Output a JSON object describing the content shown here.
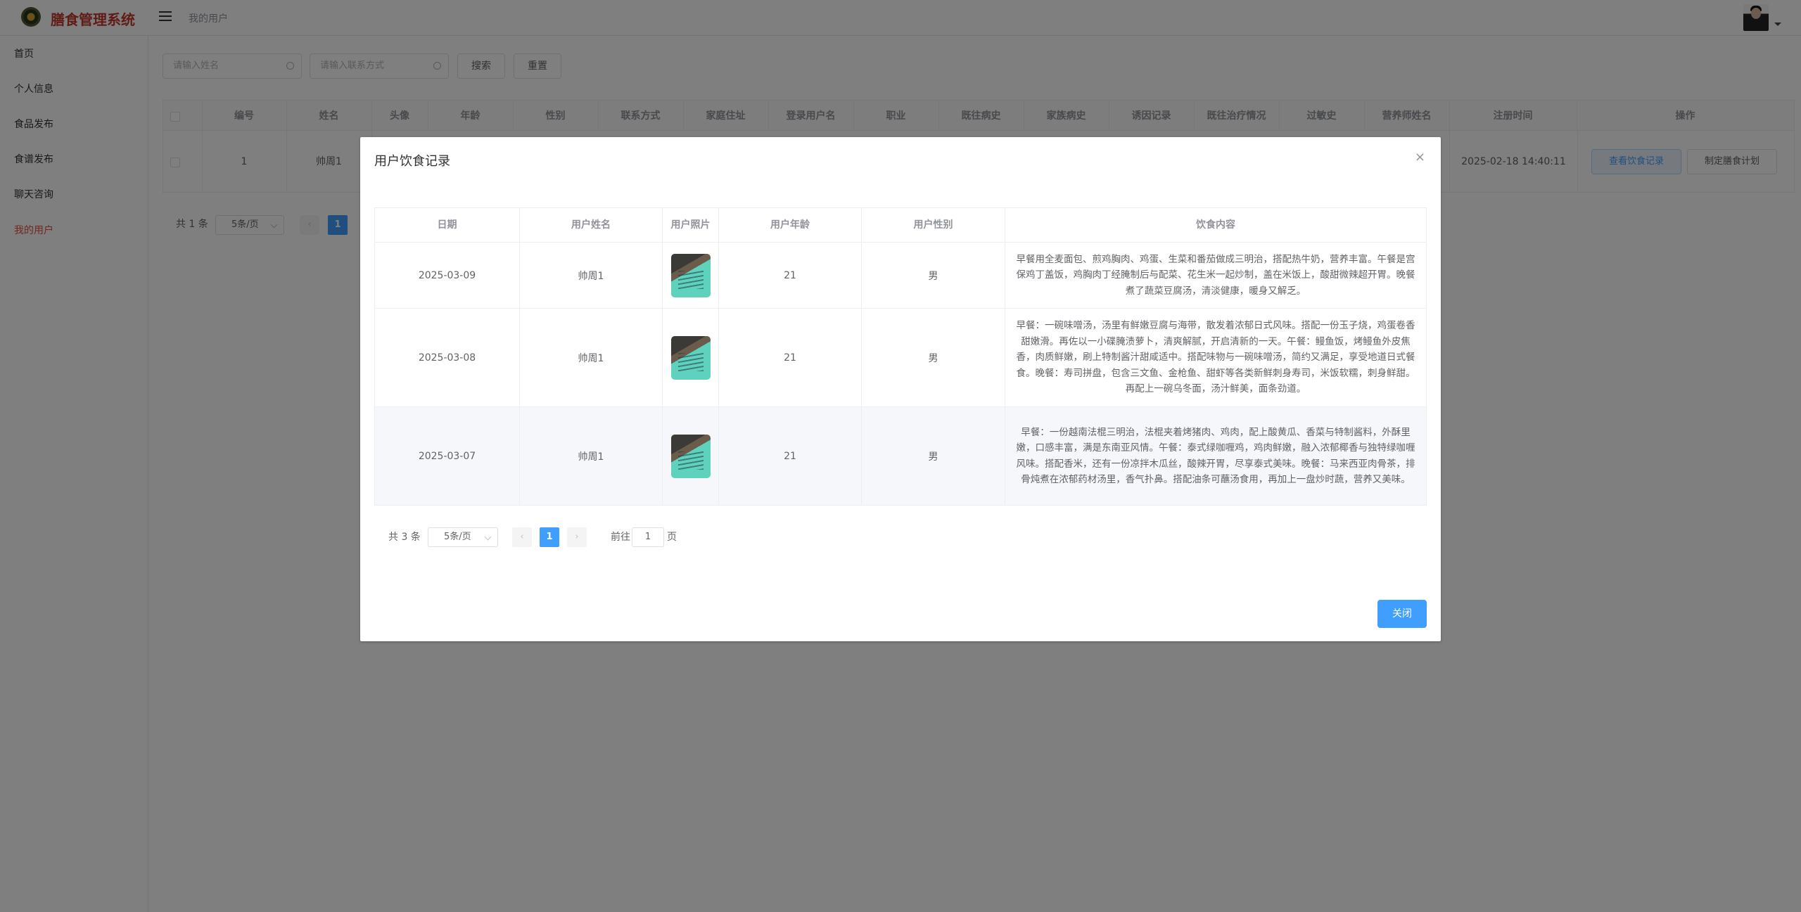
{
  "app": {
    "title": "膳食管理系统"
  },
  "header": {
    "breadcrumb": "我的用户"
  },
  "sidebar": {
    "items": [
      {
        "label": "首页"
      },
      {
        "label": "个人信息"
      },
      {
        "label": "食品发布"
      },
      {
        "label": "食谱发布"
      },
      {
        "label": "聊天咨询"
      },
      {
        "label": "我的用户"
      }
    ]
  },
  "search": {
    "name_placeholder": "请输入姓名",
    "contact_placeholder": "请输入联系方式",
    "search_label": "搜索",
    "reset_label": "重置"
  },
  "grid": {
    "headers": [
      "编号",
      "姓名",
      "头像",
      "年龄",
      "性别",
      "联系方式",
      "家庭住址",
      "登录用户名",
      "职业",
      "既往病史",
      "家族病史",
      "诱因记录",
      "既往治疗情况",
      "过敏史",
      "营养师姓名",
      "注册时间",
      "操作"
    ],
    "row": {
      "id": "1",
      "name": "帅周1",
      "registered": "2025-02-18 14:40:11"
    },
    "actions": {
      "view": "查看饮食记录",
      "plan": "制定膳食计划"
    },
    "pagination": {
      "total": "共 1 条",
      "page_size": "5条/页",
      "current": "1"
    }
  },
  "dialog": {
    "title": "用户饮食记录",
    "close_icon": "×",
    "headers": {
      "date": "日期",
      "name": "用户姓名",
      "photo": "用户照片",
      "age": "用户年龄",
      "gender": "用户性别",
      "content": "饮食内容"
    },
    "rows": [
      {
        "date": "2025-03-09",
        "name": "帅周1",
        "age": "21",
        "gender": "男",
        "content": "早餐用全麦面包、煎鸡胸肉、鸡蛋、生菜和番茄做成三明治，搭配热牛奶，营养丰富。午餐是宫保鸡丁盖饭，鸡胸肉丁经腌制后与配菜、花生米一起炒制，盖在米饭上，酸甜微辣超开胃。晚餐煮了蔬菜豆腐汤，清淡健康，暖身又解乏。"
      },
      {
        "date": "2025-03-08",
        "name": "帅周1",
        "age": "21",
        "gender": "男",
        "content": "早餐：一碗味噌汤，汤里有鲜嫩豆腐与海带，散发着浓郁日式风味。搭配一份玉子烧，鸡蛋卷香甜嫩滑。再佐以一小碟腌渍萝卜，清爽解腻，开启清新的一天。午餐：鳗鱼饭，烤鳗鱼外皮焦香，肉质鲜嫩，刷上特制酱汁甜咸适中。搭配味物与一碗味噌汤，简约又满足，享受地道日式餐食。晚餐：寿司拼盘，包含三文鱼、金枪鱼、甜虾等各类新鲜刺身寿司，米饭软糯，刺身鲜甜。再配上一碗乌冬面，汤汁鲜美，面条劲道。"
      },
      {
        "date": "2025-03-07",
        "name": "帅周1",
        "age": "21",
        "gender": "男",
        "content": "早餐：一份越南法棍三明治，法棍夹着烤猪肉、鸡肉，配上酸黄瓜、香菜与特制酱料，外酥里嫩，口感丰富，满是东南亚风情。午餐：泰式绿咖喱鸡，鸡肉鲜嫩，融入浓郁椰香与独特绿咖喱风味。搭配香米，还有一份凉拌木瓜丝，酸辣开胃，尽享泰式美味。晚餐：马来西亚肉骨茶，排骨炖煮在浓郁药材汤里，香气扑鼻。搭配油条可蘸汤食用，再加上一盘炒时蔬，营养又美味。"
      }
    ],
    "pagination": {
      "total": "共 3 条",
      "page_size": "5条/页",
      "current": "1",
      "goto_prefix": "前往",
      "goto_value": "1",
      "goto_suffix": "页"
    },
    "close_label": "关闭"
  }
}
